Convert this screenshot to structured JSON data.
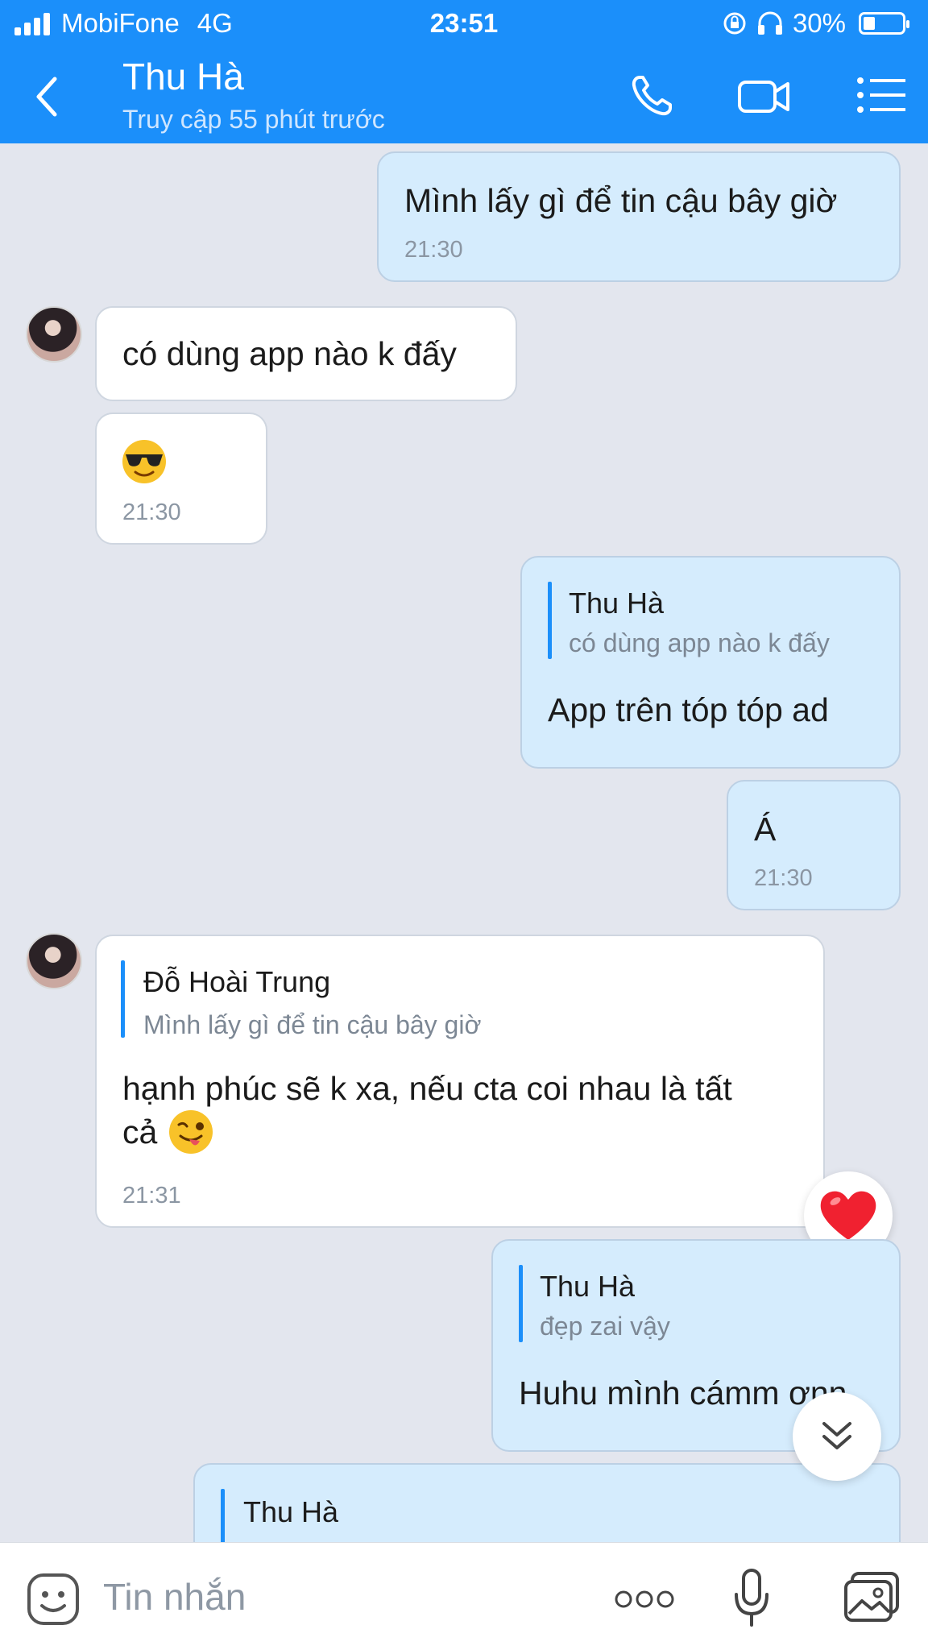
{
  "status_bar": {
    "carrier": "MobiFone",
    "network": "4G",
    "time": "23:51",
    "battery": "30%",
    "battery_level": 0.3
  },
  "header": {
    "contact_name": "Thu Hà",
    "last_seen": "Truy cập 55 phút trước"
  },
  "messages": [
    {
      "text": "Mình lấy gì để tin cậu bây giờ",
      "time": "21:30"
    },
    {
      "text": "có dùng app nào k đấy"
    },
    {
      "time": "21:30"
    },
    {
      "quote_name": "Thu Hà",
      "quote_text": "có dùng app nào k đấy",
      "text": "App trên tóp tóp ad"
    },
    {
      "text": "Á",
      "time": "21:30"
    },
    {
      "quote_name": "Đỗ Hoài Trung",
      "quote_text": "Mình lấy gì để tin cậu bây giờ",
      "text_line1": "hạnh phúc sẽ k xa, nếu cta coi nhau là tất",
      "text_line2": "cả",
      "time": "21:31"
    },
    {
      "quote_name": "Thu Hà",
      "quote_text": "đẹp zai vậy",
      "text": "Huhu mình cámm ơnn"
    },
    {
      "quote_name": "Thu Hà"
    }
  ],
  "input": {
    "placeholder": "Tin nhắn"
  },
  "icons": {
    "back": "chevron-left-icon",
    "call": "phone-icon",
    "video": "video-icon",
    "menu": "list-icon",
    "emoji": "sticker-icon",
    "more": "more-dots-icon",
    "mic": "microphone-icon",
    "image": "image-icon",
    "reaction": "heart-icon",
    "scroll": "double-chevron-down-icon"
  },
  "colors": {
    "header": "#1b8ffa",
    "mine_bubble": "#d5ecfd",
    "theirs_bubble": "#ffffff",
    "background": "#e3e6ee"
  }
}
